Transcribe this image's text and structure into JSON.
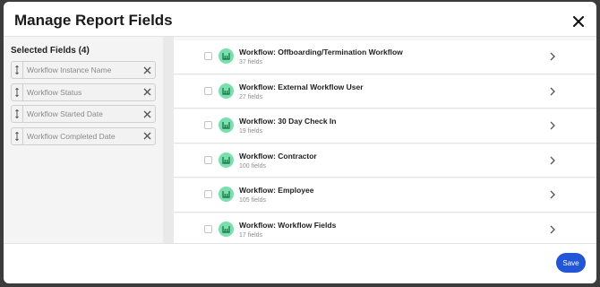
{
  "modal": {
    "title": "Manage Report Fields",
    "close_icon": "close-icon"
  },
  "selected_fields": {
    "heading": "Selected Fields (4)",
    "items": [
      {
        "label": "Workflow Instance Name"
      },
      {
        "label": "Workflow Status"
      },
      {
        "label": "Workflow Started Date"
      },
      {
        "label": "Workflow Completed Date"
      }
    ],
    "drag_icon": "drag-handle-icon",
    "remove_icon": "close-icon"
  },
  "field_groups": [
    {
      "name": "Workflow: Offboarding/Termination Workflow",
      "count": "37 fields"
    },
    {
      "name": "Workflow: External Workflow User",
      "count": "27 fields"
    },
    {
      "name": "Workflow: 30 Day Check In",
      "count": "19 fields"
    },
    {
      "name": "Workflow: Contractor",
      "count": "100 fields"
    },
    {
      "name": "Workflow: Employee",
      "count": "105 fields"
    },
    {
      "name": "Workflow: Workflow Fields",
      "count": "17 fields"
    }
  ],
  "footer": {
    "save_label": "Save"
  },
  "colors": {
    "accent": "#2356d6",
    "icon_bg": "#79dfad",
    "icon_fg": "#17663f"
  }
}
